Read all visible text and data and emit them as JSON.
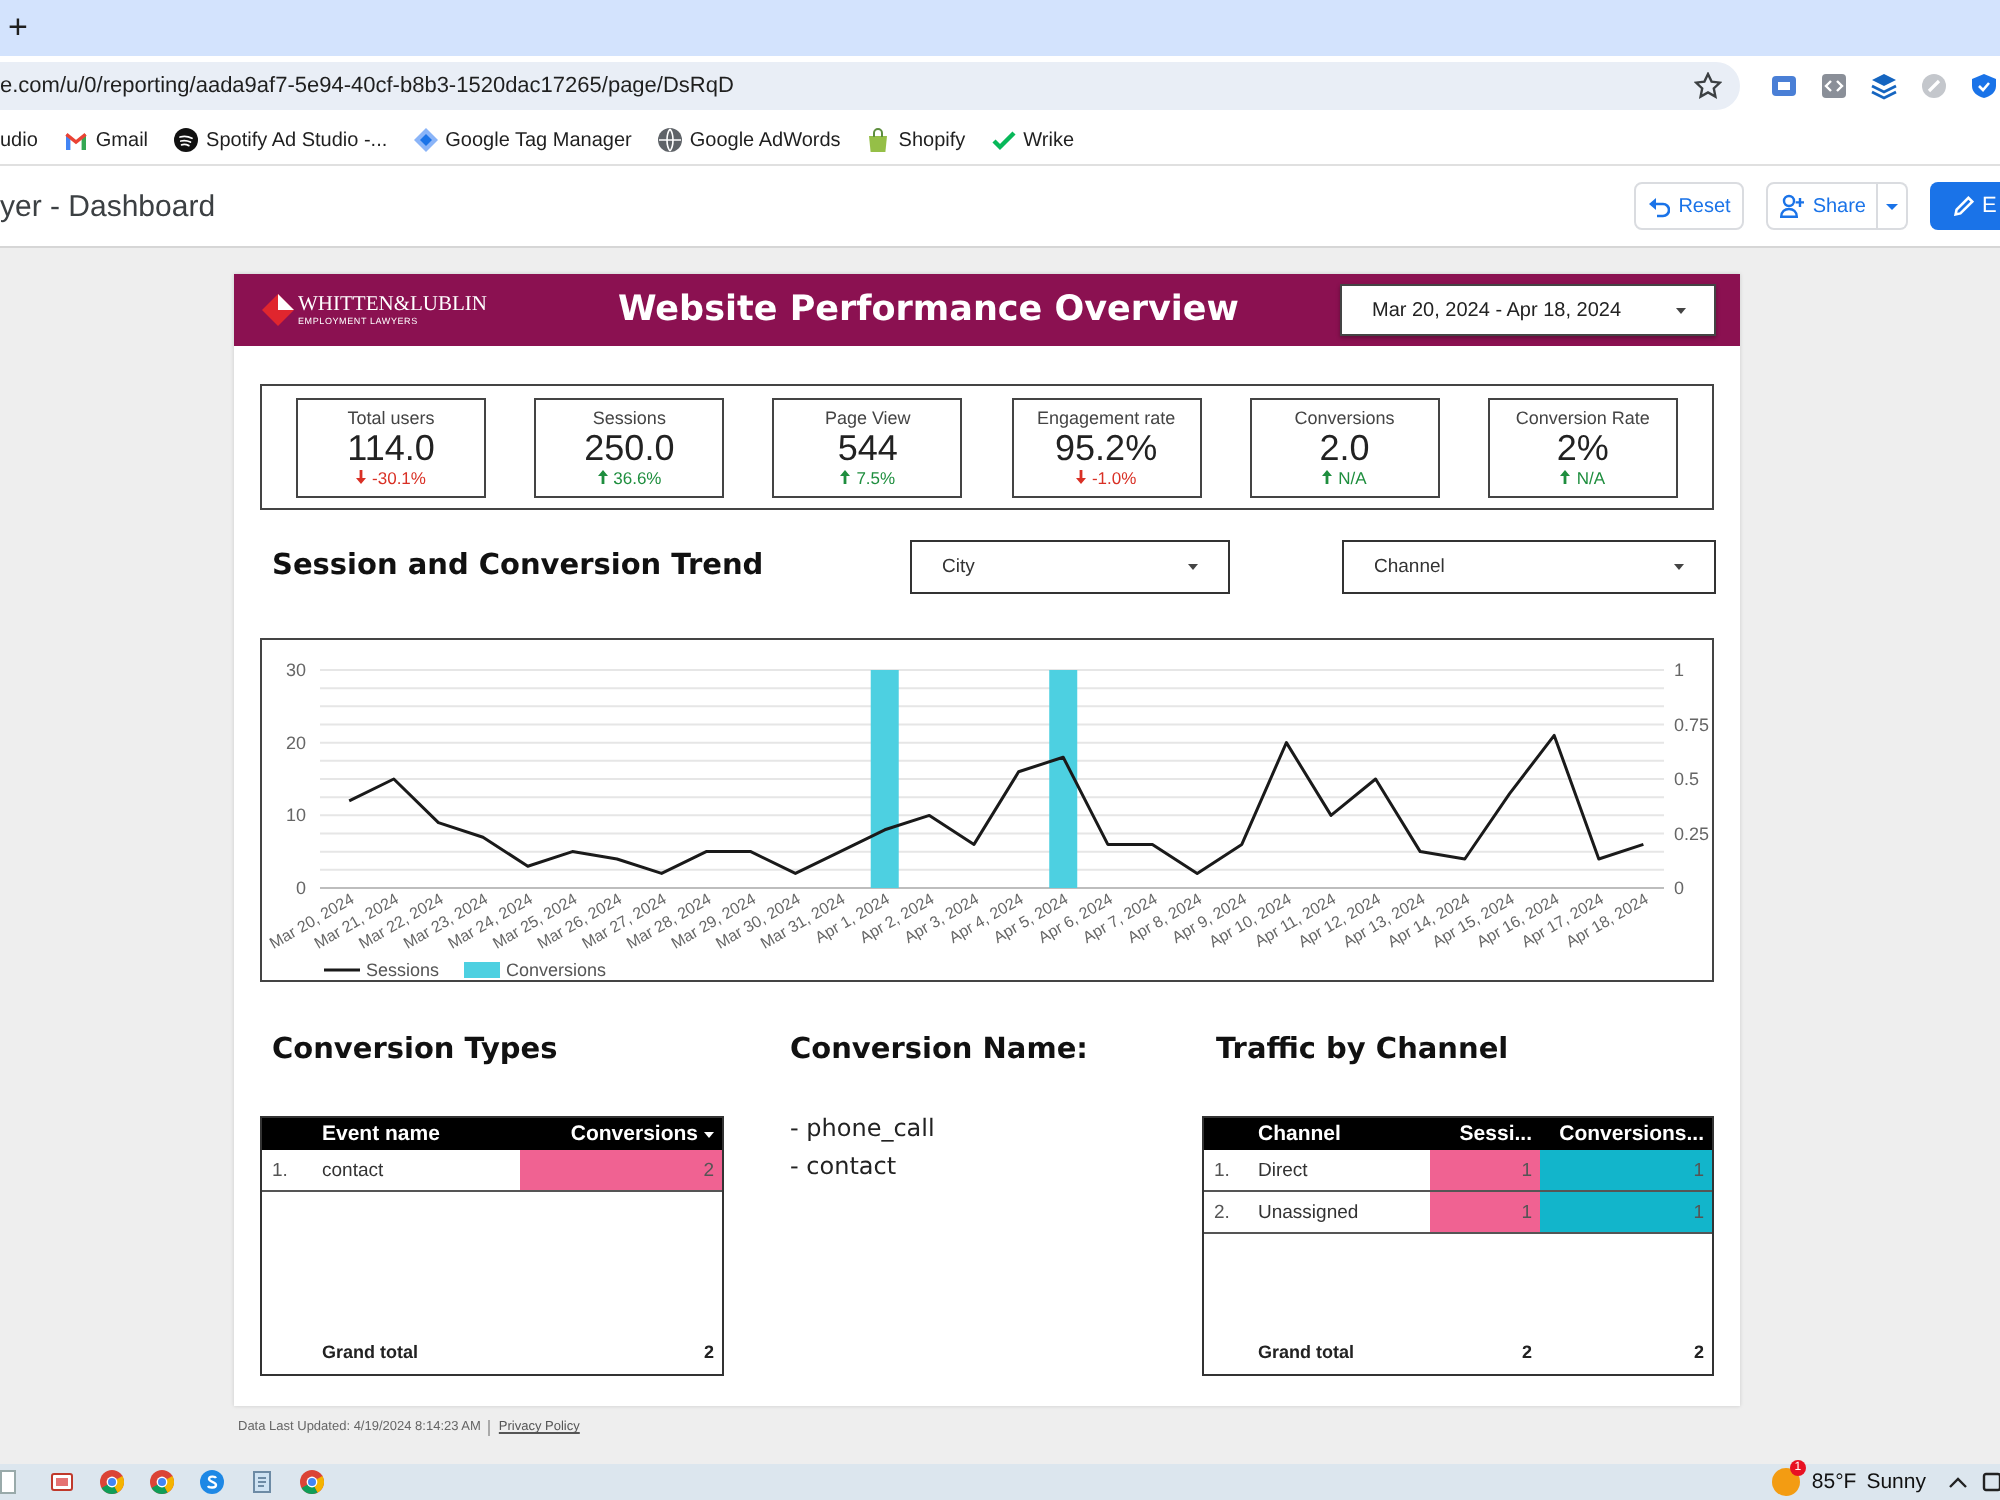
{
  "browser": {
    "new_tab": "+",
    "url": "e.com/u/0/reporting/aada9af7-5e94-40cf-b8b3-1520dac17265/page/DsRqD",
    "bookmarks": [
      {
        "label": "udio",
        "kind": "plain"
      },
      {
        "label": "Gmail",
        "kind": "mail"
      },
      {
        "label": "Spotify Ad Studio -...",
        "kind": "waves"
      },
      {
        "label": "Google Tag Manager",
        "kind": "diamond"
      },
      {
        "label": "Google AdWords",
        "kind": "globe"
      },
      {
        "label": "Shopify",
        "kind": "bag"
      },
      {
        "label": "Wrike",
        "kind": "check"
      }
    ]
  },
  "app_header": {
    "title": "yer - Dashboard",
    "buttons": [
      {
        "label": "Reset",
        "kind": "reset"
      },
      {
        "label": "Share",
        "kind": "share"
      },
      {
        "label": "E",
        "kind": "edit"
      }
    ]
  },
  "report": {
    "header": {
      "logo": {
        "name": "WHITTEN&LUBLIN",
        "tagline": "EMPLOYMENT LAWYERS"
      },
      "title": "Website Performance Overview",
      "date_range": "Mar 20, 2024 - Apr 18, 2024"
    },
    "scorecards": [
      {
        "label": "Total users",
        "value": "114.0",
        "change": "-30.1%",
        "kind": "decrease"
      },
      {
        "label": "Sessions",
        "value": "250.0",
        "change": "36.6%",
        "kind": "increase"
      },
      {
        "label": "Page View",
        "value": "544",
        "change": "7.5%",
        "kind": "increase"
      },
      {
        "label": "Engagement rate",
        "value": "95.2%",
        "change": "-1.0%",
        "kind": "decrease"
      },
      {
        "label": "Conversions",
        "value": "2.0",
        "change": "N/A",
        "kind": "increase"
      },
      {
        "label": "Conversion Rate",
        "value": "2%",
        "change": "N/A",
        "kind": "increase"
      }
    ],
    "trend": {
      "title": "Session and Conversion Trend",
      "filters": [
        {
          "label": "City"
        },
        {
          "label": "Channel"
        }
      ],
      "chart_data": {
        "type": "line",
        "categories": [
          "Mar 20, 2024",
          "Mar 21, 2024",
          "Mar 22, 2024",
          "Mar 23, 2024",
          "Mar 24, 2024",
          "Mar 25, 2024",
          "Mar 26, 2024",
          "Mar 27, 2024",
          "Mar 28, 2024",
          "Mar 29, 2024",
          "Mar 30, 2024",
          "Mar 31, 2024",
          "Apr 1, 2024",
          "Apr 2, 2024",
          "Apr 3, 2024",
          "Apr 4, 2024",
          "Apr 5, 2024",
          "Apr 6, 2024",
          "Apr 7, 2024",
          "Apr 8, 2024",
          "Apr 9, 2024",
          "Apr 10, 2024",
          "Apr 11, 2024",
          "Apr 12, 2024",
          "Apr 13, 2024",
          "Apr 14, 2024",
          "Apr 15, 2024",
          "Apr 16, 2024",
          "Apr 17, 2024",
          "Apr 18, 2024"
        ],
        "series": [
          {
            "name": "Sessions",
            "color": "#1a1a1a",
            "values": [
              12,
              15,
              9,
              7,
              3,
              5,
              4,
              2,
              5,
              5,
              2,
              5,
              8,
              10,
              6,
              16,
              18,
              6,
              6,
              2,
              6,
              20,
              10,
              15,
              5,
              4,
              13,
              21,
              4,
              6
            ]
          },
          {
            "name": "Conversions",
            "type": "bar",
            "axis": "y2",
            "color": "#4dd0e1",
            "values": [
              0,
              0,
              0,
              0,
              0,
              0,
              0,
              0,
              0,
              0,
              0,
              0,
              1,
              0,
              0,
              0,
              1,
              0,
              0,
              0,
              0,
              0,
              0,
              0,
              0,
              0,
              0,
              0,
              0,
              0
            ]
          }
        ],
        "ylim": [
          0,
          30
        ],
        "yticks": [
          0,
          10,
          20,
          30
        ],
        "y2lim": [
          0,
          1
        ],
        "y2ticks": [
          0,
          0.25,
          0.5,
          0.75,
          1
        ],
        "grid": true,
        "legend": "bottom-left"
      }
    },
    "conversion_types": {
      "title": "Conversion Types",
      "columns": [
        {
          "label": "Event name",
          "sorted": false
        },
        {
          "label": "Conversions",
          "sorted": true,
          "color": "#f06292"
        }
      ],
      "rows": [
        {
          "index": "1.",
          "cells": [
            "contact",
            "2"
          ]
        }
      ],
      "total": [
        "Grand total",
        "2"
      ]
    },
    "conversion_names": {
      "title": "Conversion Name:",
      "items": [
        "- phone_call",
        "- contact"
      ]
    },
    "traffic_by_channel": {
      "title": "Traffic by Channel",
      "columns": [
        {
          "label": "Channel",
          "sorted": false
        },
        {
          "label": "Sessi...",
          "sorted": false,
          "color": "#f06292"
        },
        {
          "label": "Conversions...",
          "sorted": false,
          "color": "#12b5cb"
        }
      ],
      "rows": [
        {
          "index": "1.",
          "cells": [
            "Direct",
            "1",
            "1"
          ]
        },
        {
          "index": "2.",
          "cells": [
            "Unassigned",
            "1",
            "1"
          ]
        }
      ],
      "total": [
        "Grand total",
        "2",
        "2"
      ]
    }
  },
  "footer": {
    "updated": "Data Last Updated: 4/19/2024 8:14:23 AM",
    "link": "Privacy Policy"
  },
  "taskbar": {
    "badge": "1",
    "temperature": "85°F",
    "condition": "Sunny"
  }
}
